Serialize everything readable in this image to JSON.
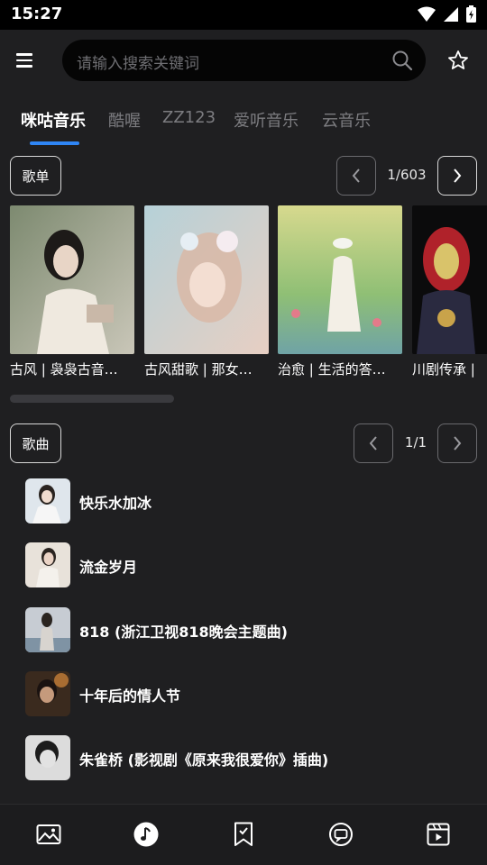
{
  "status_bar": {
    "time": "15:27"
  },
  "header": {
    "search_placeholder": "请输入搜索关键词"
  },
  "tabs": [
    {
      "label": "咪咕音乐",
      "active": true
    },
    {
      "label": "酷喔",
      "active": false
    },
    {
      "label": "ZZ123",
      "active": false
    },
    {
      "label": "爱听音乐",
      "active": false
    },
    {
      "label": "云音乐",
      "active": false
    }
  ],
  "playlists": {
    "section_label": "歌单",
    "pager": "1/603",
    "items": [
      {
        "caption": "古风 | 袅袅古音…"
      },
      {
        "caption": "古风甜歌 | 那女…"
      },
      {
        "caption": "治愈 | 生活的答…"
      },
      {
        "caption": "川剧传承 |"
      }
    ]
  },
  "songs": {
    "section_label": "歌曲",
    "pager": "1/1",
    "items": [
      {
        "title": "快乐水加冰"
      },
      {
        "title": "流金岁月"
      },
      {
        "title": "818 (浙江卫视818晚会主题曲)"
      },
      {
        "title": "十年后的情人节"
      },
      {
        "title": "朱雀桥 (影视剧《原来我很爱你》插曲)"
      }
    ]
  },
  "bottom_nav": [
    {
      "icon": "image-icon",
      "active": false
    },
    {
      "icon": "music-note-icon",
      "active": true
    },
    {
      "icon": "bookmark-icon",
      "active": false
    },
    {
      "icon": "chat-icon",
      "active": false
    },
    {
      "icon": "video-icon",
      "active": false
    }
  ],
  "colors": {
    "background": "#1f1f21",
    "accent": "#2f86f6",
    "status_bar": "#000000"
  }
}
